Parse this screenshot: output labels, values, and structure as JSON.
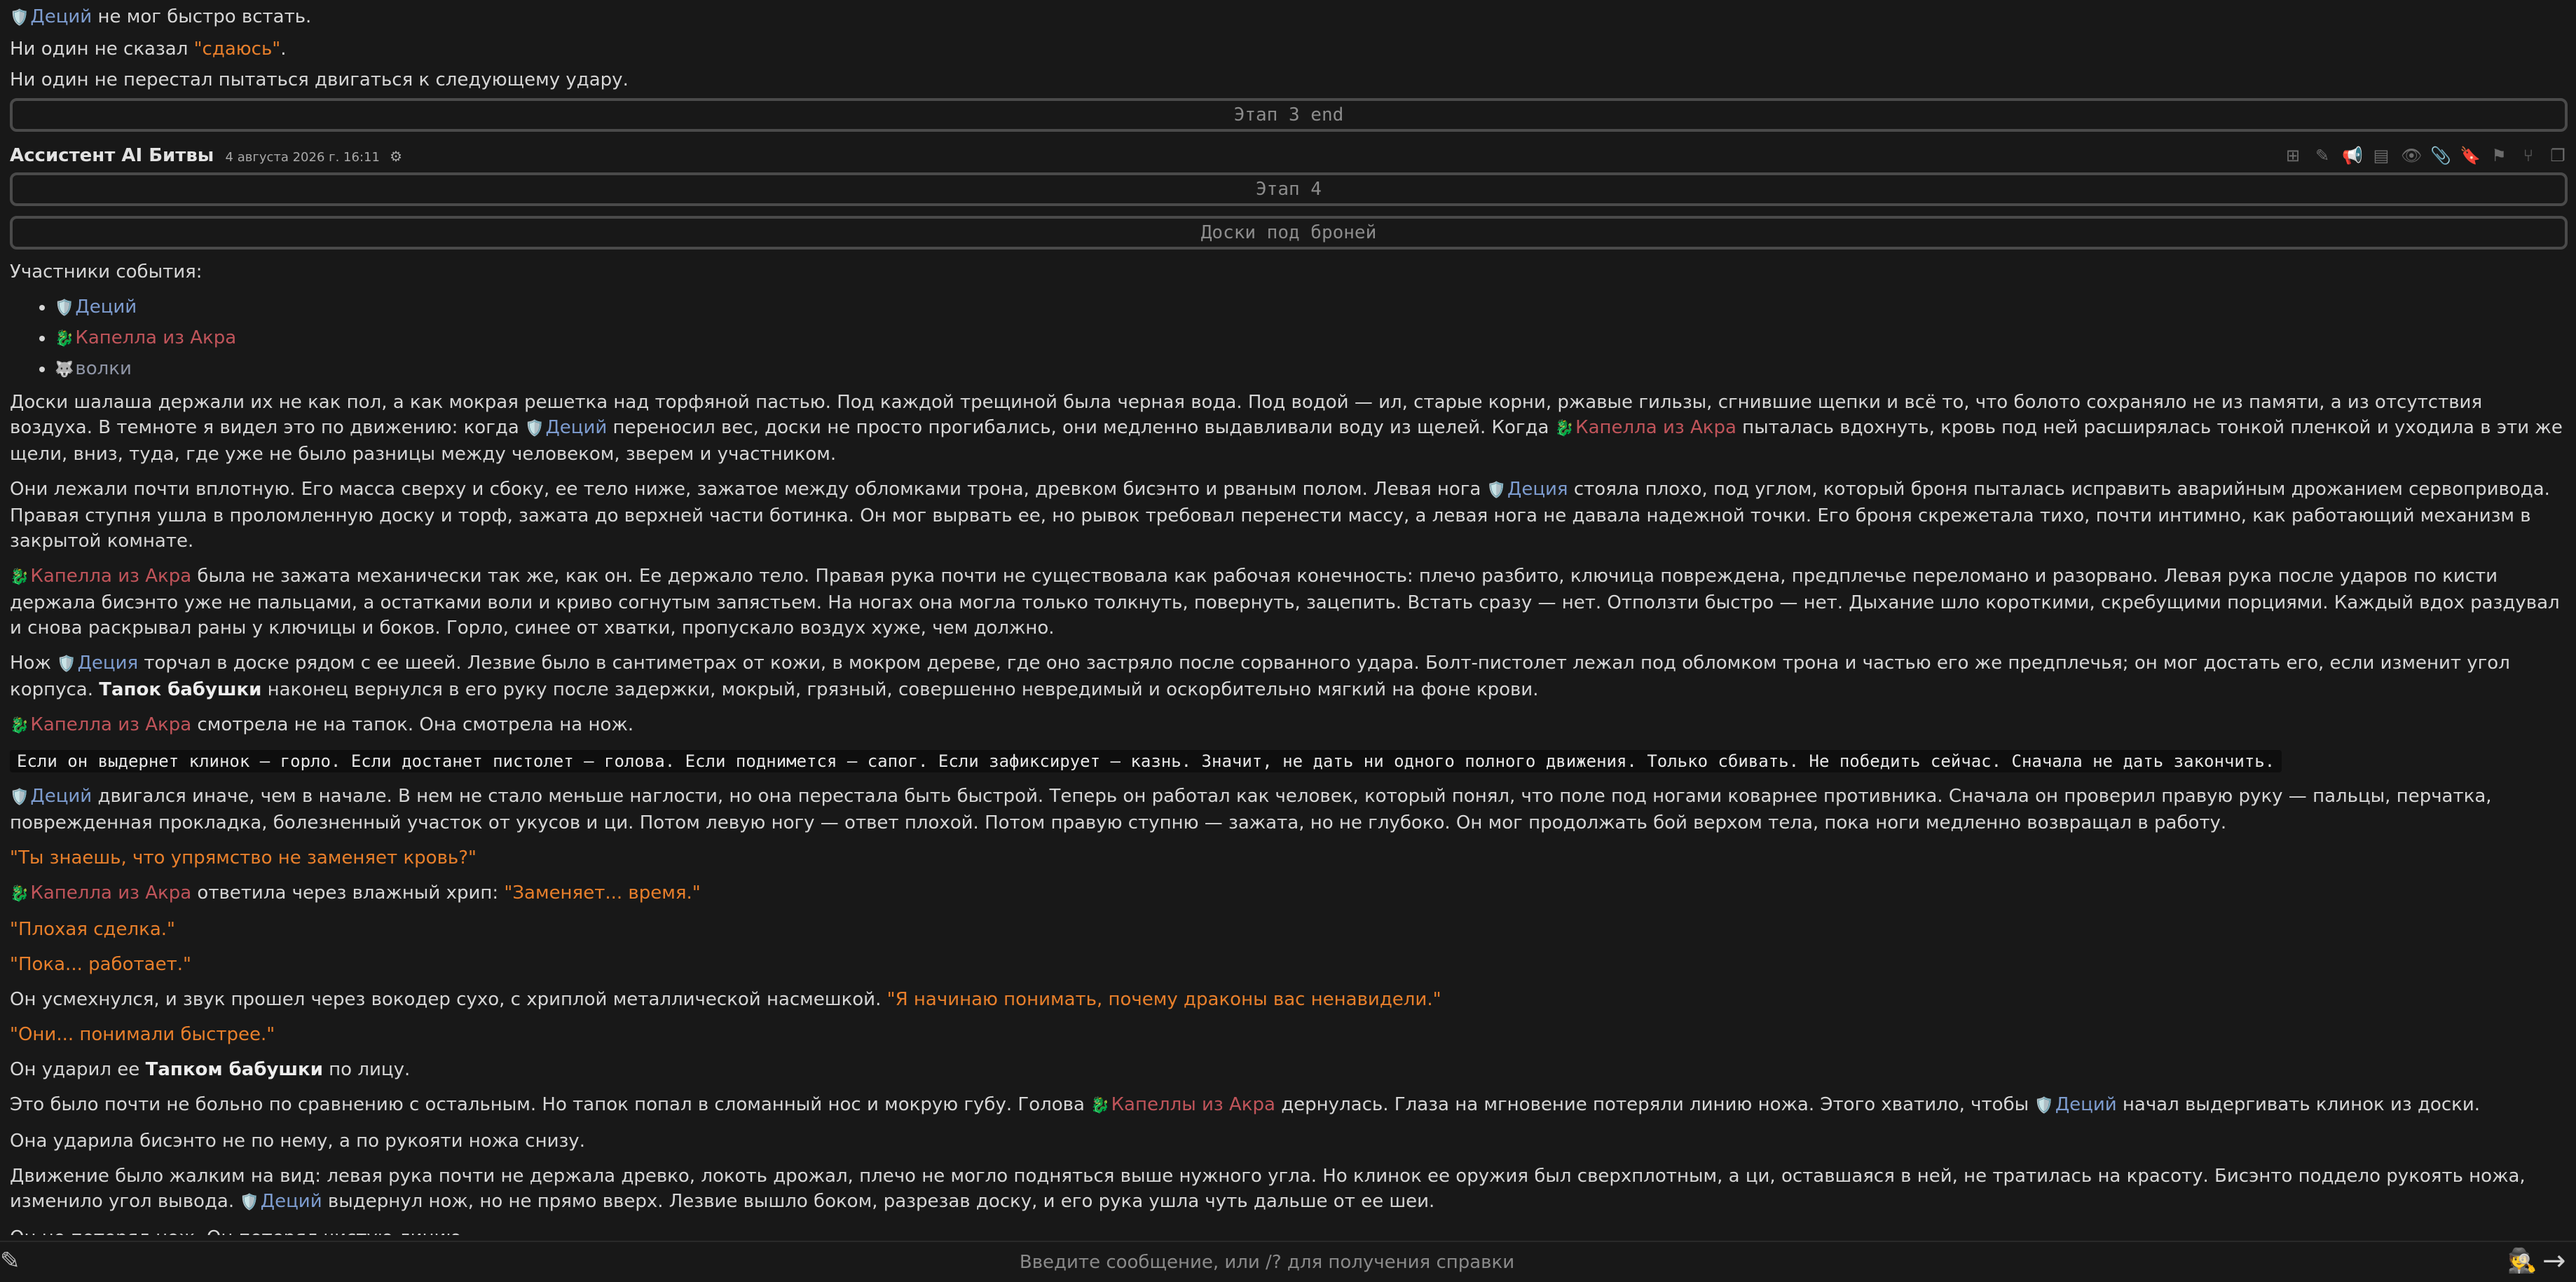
{
  "icons": {
    "decius": "🛡️",
    "kapella": "🐉",
    "wolves": "🐺"
  },
  "colors": {
    "background": "#181818",
    "text": "#d6d6d6",
    "decius": "#7d9ccf",
    "kapella": "#c0545a",
    "quote": "#e87f2b"
  },
  "prev": {
    "p1": {
      "name": "Деций",
      "text": " не мог быстро встать."
    },
    "p2": {
      "pre": "Ни один не сказал ",
      "quote": "\"сдаюсь\"",
      "post": "."
    },
    "p3": "Ни один не перестал пытаться двигаться к следующему удару.",
    "stage_end": "Этап 3 end"
  },
  "message": {
    "author": "Ассистент AI Битвы",
    "timestamp": "4 августа 2026 г. 16:11",
    "stage": "Этап 4",
    "subtitle": "Доски под броней",
    "participants_label": "Участники события:",
    "participants": [
      "Деций",
      "Капелла из Акра",
      "волки"
    ],
    "p1": {
      "a": "Доски шалаша держали их не как пол, а как мокрая решетка над торфяной пастью. Под каждой трещиной была черная вода. Под водой — ил, старые корни, ржавые гильзы, сгнившие щепки и всё то, что болото сохраняло не из памяти, а из отсутствия воздуха. В темноте я видел это по движению: когда ",
      "n1": "Деций",
      "b": " переносил вес, доски не просто прогибались, они медленно выдавливали воду из щелей. Когда ",
      "n2": "Капелла из Акра",
      "c": " пыталась вдохнуть, кровь под ней расширялась тонкой пленкой и уходила в эти же щели, вниз, туда, где уже не было разницы между человеком, зверем и участником."
    },
    "p2": {
      "a": "Они лежали почти вплотную. Его масса сверху и сбоку, ее тело ниже, зажатое между обломками трона, древком бисэнто и рваным полом. Левая нога ",
      "n1": "Деция",
      "b": " стояла плохо, под углом, который броня пыталась исправить аварийным дрожанием сервопривода. Правая ступня ушла в проломленную доску и торф, зажата до верхней части ботинка. Он мог вырвать ее, но рывок требовал перенести массу, а левая нога не давала надежной точки. Его броня скрежетала тихо, почти интимно, как работающий механизм в закрытой комнате."
    },
    "p3": {
      "n1": "Капелла из Акра",
      "a": " была не зажата механически так же, как он. Ее держало тело. Правая рука почти не существовала как рабочая конечность: плечо разбито, ключица повреждена, предплечье переломано и разорвано. Левая рука после ударов по кисти держала бисэнто уже не пальцами, а остатками воли и криво согнутым запястьем. На ногах она могла только толкнуть, повернуть, зацепить. Встать сразу — нет. Отползти быстро — нет. Дыхание шло короткими, скребущими порциями. Каждый вдох раздувал и снова раскрывал раны у ключицы и боков. Горло, синее от хватки, пропускало воздух хуже, чем должно."
    },
    "p4": {
      "a": "Нож ",
      "n1": "Деция",
      "b": " торчал в доске рядом с ее шеей. Лезвие было в сантиметрах от кожи, в мокром дереве, где оно застряло после сорванного удара. Болт-пистолет лежал под обломком трона и частью его же предплечья; он мог достать его, если изменит угол корпуса. ",
      "bold": "Тапок бабушки",
      "c": " наконец вернулся в его руку после задержки, мокрый, грязный, совершенно невредимый и оскорбительно мягкий на фоне крови."
    },
    "p5": {
      "n1": "Капелла из Акра",
      "a": " смотрела не на тапок. Она смотрела на нож."
    },
    "p6_code": "Если он выдернет клинок — горло. Если достанет пистолет — голова. Если поднимется — сапог. Если зафиксирует — казнь. Значит, не дать ни одного полного движения. Только сбивать. Не победить сейчас. Сначала не дать закончить.",
    "p7": {
      "n1": "Деций",
      "a": " двигался иначе, чем в начале. В нем не стало меньше наглости, но она перестала быть быстрой. Теперь он работал как человек, который понял, что поле под ногами коварнее противника. Сначала он проверил правую руку — пальцы, перчатка, поврежденная прокладка, болезненный участок от укусов и ци. Потом левую ногу — ответ плохой. Потом правую ступню — зажата, но не глубоко. Он мог продолжать бой верхом тела, пока ноги медленно возвращал в работу."
    },
    "p8": "\"Ты знаешь, что упрямство не заменяет кровь?\"",
    "p9": {
      "n1": "Капелла из Акра",
      "a": " ответила через влажный хрип: ",
      "q": "\"Заменяет... время.\""
    },
    "p10": "\"Плохая сделка.\"",
    "p11": "\"Пока... работает.\"",
    "p12": {
      "a": "Он усмехнулся, и звук прошел через вокодер сухо, с хриплой металлической насмешкой. ",
      "q": "\"Я начинаю понимать, почему драконы вас ненавидели.\""
    },
    "p13": "\"Они... понимали быстрее.\"",
    "p14": {
      "a": "Он ударил ее ",
      "bold": "Тапком бабушки",
      "b": " по лицу."
    },
    "p15": {
      "a": "Это было почти не больно по сравнению с остальным. Но тапок попал в сломанный нос и мокрую губу. Голова ",
      "n1": "Капеллы из Акра",
      "b": " дернулась. Глаза на мгновение потеряли линию ножа. Этого хватило, чтобы ",
      "n2": "Деций",
      "c": " начал выдергивать клинок из доски."
    },
    "p16": "Она ударила бисэнто не по нему, а по рукояти ножа снизу.",
    "p17": {
      "a": "Движение было жалким на вид: левая рука почти не держала древко, локоть дрожал, плечо не могло подняться выше нужного угла. Но клинок ее оружия был сверхплотным, а ци, оставшаяся в ней, не тратилась на красоту. Бисэнто поддело рукоять ножа, изменило угол вывода. ",
      "n1": "Деций",
      "b": " выдернул нож, но не прямо вверх. Лезвие вышло боком, разрезав доску, и его рука ушла чуть дальше от ее шеи."
    },
    "p18": "Он не потерял нож. Он потерял чистую линию."
  },
  "input": {
    "placeholder": "Введите сообщение, или /? для получения справки"
  }
}
